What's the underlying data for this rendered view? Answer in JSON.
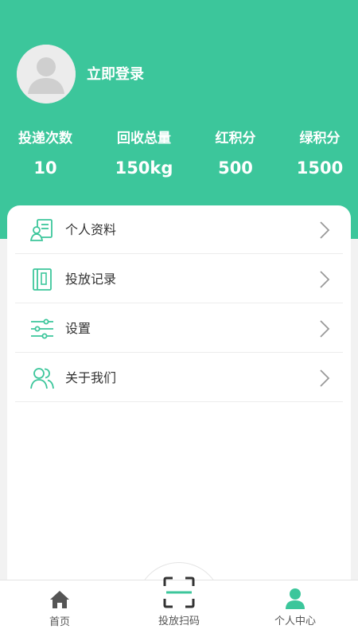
{
  "profile": {
    "login_label": "立即登录"
  },
  "stats": [
    {
      "label": "投递次数",
      "value": "10"
    },
    {
      "label": "回收总量",
      "value": "150kg"
    },
    {
      "label": "红积分",
      "value": "500"
    },
    {
      "label": "绿积分",
      "value": "1500"
    }
  ],
  "menu": [
    {
      "label": "个人资料",
      "icon": "profile-card-icon"
    },
    {
      "label": "投放记录",
      "icon": "record-book-icon"
    },
    {
      "label": "设置",
      "icon": "sliders-icon"
    },
    {
      "label": "关于我们",
      "icon": "users-icon"
    }
  ],
  "tabbar": {
    "home": "首页",
    "scan": "投放扫码",
    "me": "个人中心"
  },
  "colors": {
    "brand": "#3cc69b",
    "tab_active": "#3cc69b",
    "tab_inactive": "#555555"
  }
}
